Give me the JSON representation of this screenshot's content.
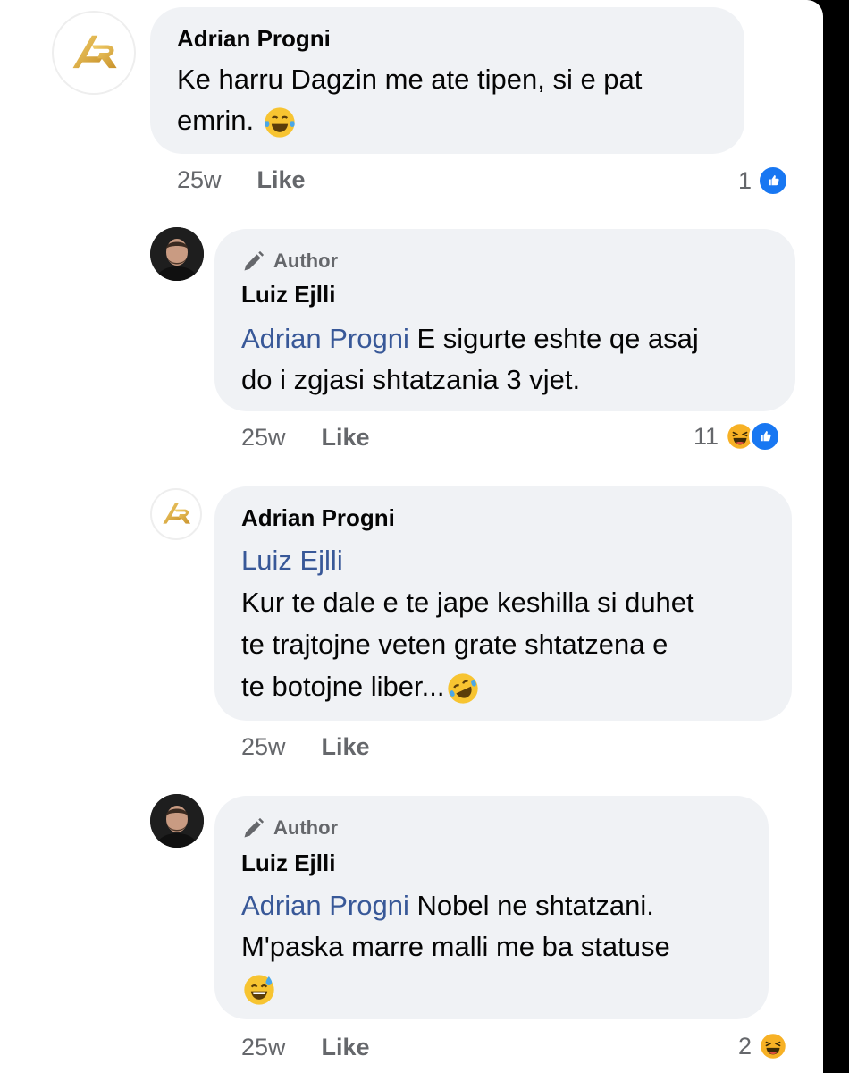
{
  "comments": [
    {
      "author": "Adrian Progni",
      "is_author": false,
      "mention": "",
      "lines": [
        "Ke harru Dagzin me ate tipen, si e pat",
        "emrin."
      ],
      "time": "25w",
      "like_label": "Like",
      "reaction_count": "1",
      "reactions": [
        "like-icon"
      ]
    },
    {
      "author": "Luiz Ejlli",
      "is_author": true,
      "author_badge": "Author",
      "mention": "Adrian Progni",
      "lines": [
        " E sigurte eshte qe asaj",
        "do i zgjasi shtatzania 3 vjet."
      ],
      "time": "25w",
      "like_label": "Like",
      "reaction_count": "11",
      "reactions": [
        "haha-icon",
        "like-icon"
      ]
    },
    {
      "author": "Adrian Progni",
      "is_author": false,
      "mention": "Luiz Ejlli",
      "lines": [
        "Kur te dale e te jape keshilla si duhet",
        "te trajtojne veten grate shtatzena e",
        "te botojne liber..."
      ],
      "time": "25w",
      "like_label": "Like",
      "reaction_count": "",
      "reactions": []
    },
    {
      "author": "Luiz Ejlli",
      "is_author": true,
      "author_badge": "Author",
      "mention": "Adrian Progni",
      "lines": [
        " Nobel ne shtatzani.",
        "M'paska marre malli me ba statuse",
        ""
      ],
      "time": "25w",
      "like_label": "Like",
      "reaction_count": "2",
      "reactions": [
        "haha-icon"
      ]
    }
  ],
  "emojis": {
    "c1": "face-with-tears-of-joy",
    "c3": "rolling-on-the-floor-laughing",
    "c4": "grinning-face-with-sweat"
  },
  "colors": {
    "bubble": "#f0f2f5",
    "mention": "#385898",
    "like_blue": "#1877f2",
    "haha_yellow": "#f7b125"
  }
}
